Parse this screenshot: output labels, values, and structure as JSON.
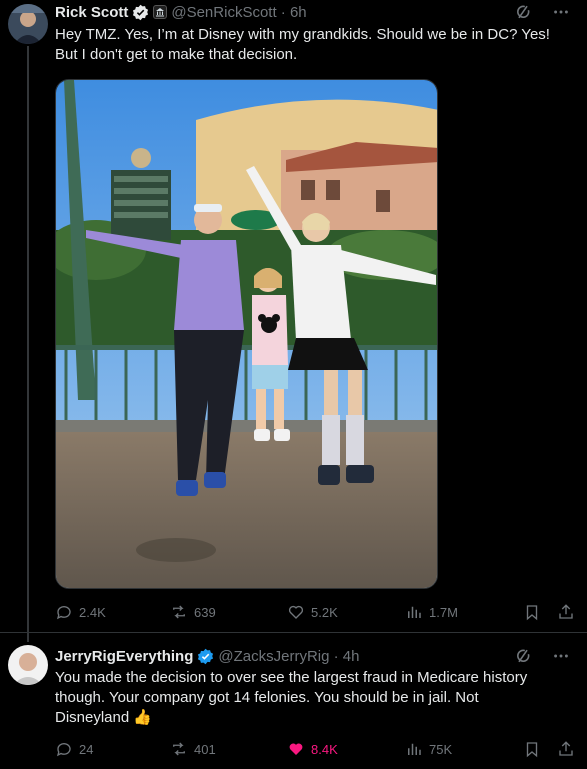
{
  "tweet": {
    "author_name": "Rick Scott",
    "handle_time": "@SenRickScott · 6h",
    "text_line1": "Hey TMZ. Yes, I’m at Disney with my grandkids. Should we be in DC? Yes!",
    "text_line2": "But I don't get to make that decision.",
    "replies": "2.4K",
    "reposts": "639",
    "likes": "5.2K",
    "views": "1.7M"
  },
  "reply": {
    "author_name": "JerryRigEverything",
    "handle_time": "@ZacksJerryRig · 4h",
    "text_line1": "You made the decision to over see the largest fraud in Medicare history",
    "text_line2": "though.  Your company got 14 felonies. You should be in jail.  Not",
    "text_line3": "Disneyland 👍",
    "replies": "24",
    "reposts": "401",
    "likes": "8.4K",
    "views": "75K"
  },
  "colors": {
    "background": "#000000",
    "text": "#e7e9ea",
    "muted": "#71767b",
    "verified_blue": "#1d9bf0",
    "like_pink": "#f91880"
  },
  "icons": [
    "verified-badge-icon",
    "grok-icon",
    "more-icon",
    "reply-icon",
    "repost-icon",
    "like-icon",
    "views-icon",
    "bookmark-icon",
    "share-icon"
  ]
}
